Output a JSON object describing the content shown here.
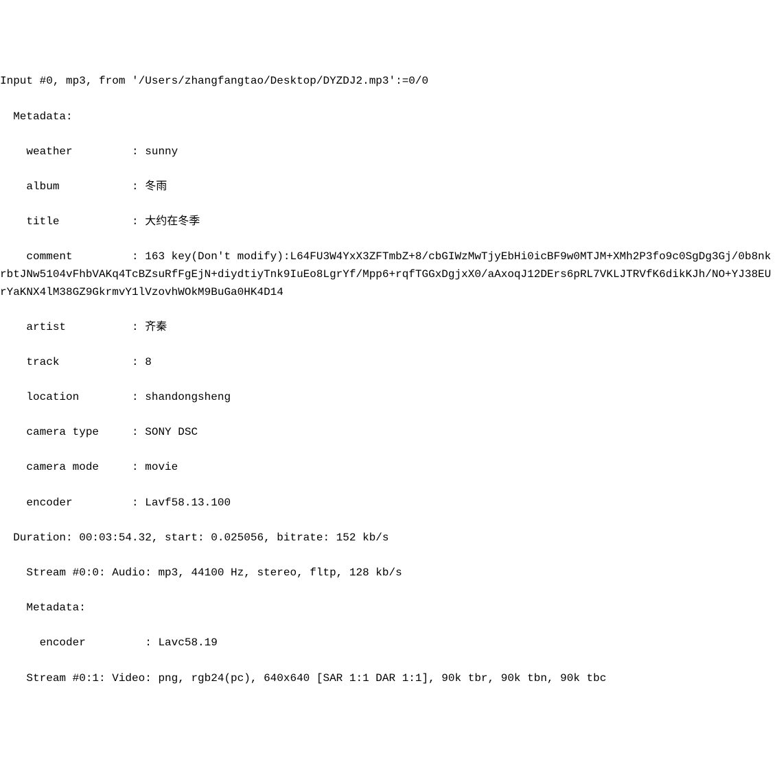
{
  "input_header": "Input #0, mp3, from '/Users/zhangfangtao/Desktop/DYZDJ2.mp3':=0/0",
  "metadata_label": "  Metadata:",
  "metadata": {
    "weather": {
      "key": "    weather         ",
      "sep": ": ",
      "value": "sunny"
    },
    "album": {
      "key": "    album           ",
      "sep": ": ",
      "value": "冬雨"
    },
    "title": {
      "key": "    title           ",
      "sep": ": ",
      "value": "大约在冬季"
    },
    "comment": {
      "key": "    comment         ",
      "sep": ": ",
      "value": "163 key(Don't modify):L64FU3W4YxX3ZFTmbZ+8/cbGIWzMwTjyEbHi0icBF9w0MTJM+XMh2P3fo9c0SgDg3Gj/0b8nkrbtJNw5104vFhbVAKq4TcBZsuRfFgEjN+diydtiyTnk9IuEo8LgrYf/Mpp6+rqfTGGxDgjxX0/aAxoqJ12DErs6pRL7VKLJTRVfK6dikKJh/NO+YJ38EUrYaKNX4lM38GZ9GkrmvY1lVzovhWOkM9BuGa0HK4D14"
    },
    "artist": {
      "key": "    artist          ",
      "sep": ": ",
      "value": "齐秦"
    },
    "track": {
      "key": "    track           ",
      "sep": ": ",
      "value": "8"
    },
    "location": {
      "key": "    location        ",
      "sep": ": ",
      "value": "shandongsheng"
    },
    "camera_type": {
      "key": "    camera type     ",
      "sep": ": ",
      "value": "SONY DSC"
    },
    "camera_mode": {
      "key": "    camera mode     ",
      "sep": ": ",
      "value": "movie"
    },
    "encoder": {
      "key": "    encoder         ",
      "sep": ": ",
      "value": "Lavf58.13.100"
    }
  },
  "duration_line": "  Duration: 00:03:54.32, start: 0.025056, bitrate: 152 kb/s",
  "stream0": "    Stream #0:0: Audio: mp3, 44100 Hz, stereo, fltp, 128 kb/s",
  "stream0_metadata_label": "    Metadata:",
  "stream0_encoder": {
    "key": "      encoder         ",
    "sep": ": ",
    "value": "Lavc58.19"
  },
  "stream1": "    Stream #0:1: Video: png, rgb24(pc), 640x640 [SAR 1:1 DAR 1:1], 90k tbr, 90k tbn, 90k tbc"
}
